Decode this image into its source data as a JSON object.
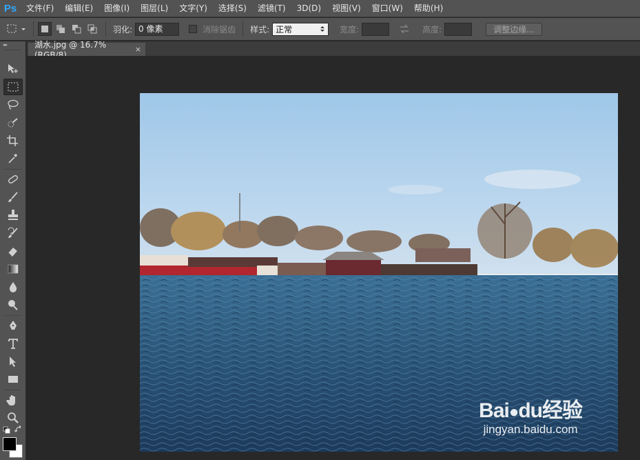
{
  "app": {
    "logo": "Ps"
  },
  "menu": [
    "文件(F)",
    "编辑(E)",
    "图像(I)",
    "图层(L)",
    "文字(Y)",
    "选择(S)",
    "滤镜(T)",
    "3D(D)",
    "视图(V)",
    "窗口(W)",
    "帮助(H)"
  ],
  "options": {
    "feather_label": "羽化:",
    "feather_value": "0 像素",
    "antialias_label": "消除锯齿",
    "style_label": "样式:",
    "style_value": "正常",
    "width_label": "宽度:",
    "height_label": "高度:",
    "refine_edge": "调整边缘..."
  },
  "document": {
    "tab_title": "湖水.jpg @ 16.7%(RGB/8)",
    "close_glyph": "×"
  },
  "tools": [
    "move-tool",
    "rectangular-marquee-tool",
    "lasso-tool",
    "quick-selection-tool",
    "crop-tool",
    "eyedropper-tool",
    "spot-healing-brush-tool",
    "brush-tool",
    "clone-stamp-tool",
    "history-brush-tool",
    "eraser-tool",
    "gradient-tool",
    "blur-tool",
    "dodge-tool",
    "pen-tool",
    "type-tool",
    "path-selection-tool",
    "rectangle-tool",
    "hand-tool",
    "zoom-tool"
  ],
  "colors": {
    "foreground": "#000000",
    "background": "#ffffff",
    "accent": "#31a8ff"
  },
  "watermark": {
    "brand": "Bai",
    "brand_du": "du",
    "brand_cn": "经验",
    "url": "jingyan.baidu.com"
  }
}
